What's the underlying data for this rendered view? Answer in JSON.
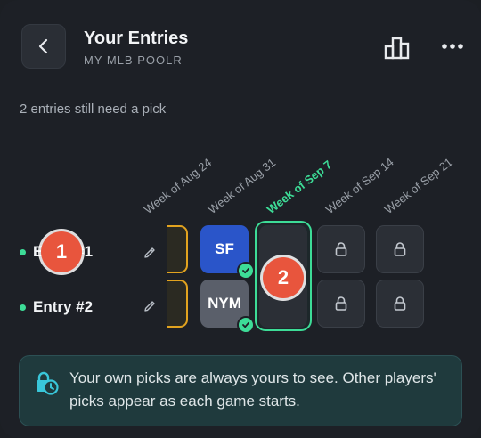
{
  "header": {
    "title": "Your Entries",
    "subtitle": "MY MLB POOLR"
  },
  "notice": "2 entries still need a pick",
  "weeks": [
    {
      "label": "Week of Aug 24",
      "current": false
    },
    {
      "label": "Week of Aug 31",
      "current": false
    },
    {
      "label": "Week of Sep 7",
      "current": true
    },
    {
      "label": "Week of Sep 14",
      "current": false
    },
    {
      "label": "Week of Sep 21",
      "current": false
    }
  ],
  "entries": [
    {
      "name": "Entry #1",
      "picks": {
        "aug31": "SF"
      }
    },
    {
      "name": "Entry #2",
      "picks": {
        "aug31": "NYM"
      }
    }
  ],
  "markers": [
    "1",
    "2"
  ],
  "info": {
    "text": "Your own picks are always yours to see. Other players' picks appear as each game starts."
  },
  "colors": {
    "accent": "#3ddc97",
    "marker": "#e8553d",
    "sf": "#2a55c9",
    "nym": "#5a5f6a",
    "previous_week_border": "#e2a31f"
  }
}
